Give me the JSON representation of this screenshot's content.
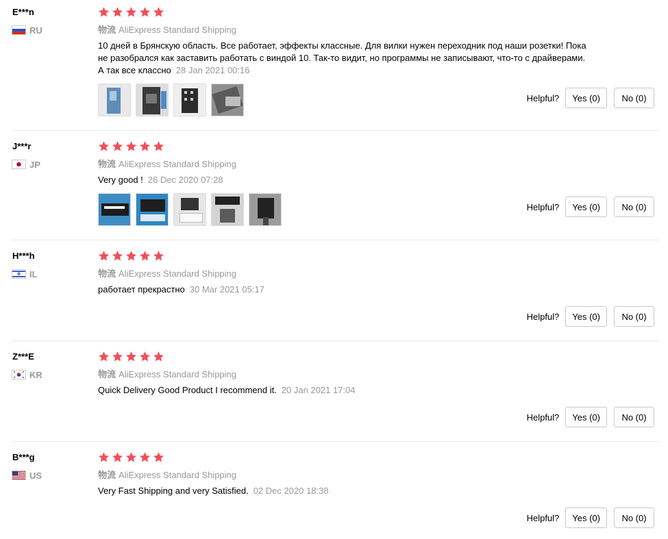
{
  "shipping_label": "物流",
  "helpful_label": "Helpful?",
  "star_color": "#f0505a",
  "reviews": [
    {
      "user": "E***n",
      "country": "RU",
      "flag": "russia-flag-icon",
      "shipping": "AliExpress Standard Shipping",
      "text": "10 дней в Брянскую область. Все работает, эффекты классные. Для вилки нужен переходник под наши розетки! Пока не разобрался как заставить работать с виндой 10. Так-то видит, но программы не записывают, что-то с драйверами. А так все классно",
      "date": "28 Jan 2021 00:16",
      "photo_count": 4,
      "yes": "Yes (0)",
      "no": "No (0)"
    },
    {
      "user": "J***r",
      "country": "JP",
      "flag": "japan-flag-icon",
      "shipping": "AliExpress Standard Shipping",
      "text": "Very good !",
      "date": "26 Dec 2020 07:28",
      "photo_count": 5,
      "yes": "Yes (0)",
      "no": "No (0)"
    },
    {
      "user": "H***h",
      "country": "IL",
      "flag": "israel-flag-icon",
      "shipping": "AliExpress Standard Shipping",
      "text": "работает прекрастно",
      "date": "30 Mar 2021 05:17",
      "photo_count": 0,
      "yes": "Yes (0)",
      "no": "No (0)"
    },
    {
      "user": "Z***E",
      "country": "KR",
      "flag": "south-korea-flag-icon",
      "shipping": "AliExpress Standard Shipping",
      "text": "Quick Delivery Good Product I recommend it.",
      "date": "20 Jan 2021 17:04",
      "photo_count": 0,
      "yes": "Yes (0)",
      "no": "No (0)"
    },
    {
      "user": "B***g",
      "country": "US",
      "flag": "usa-flag-icon",
      "shipping": "AliExpress Standard Shipping",
      "text": "Very Fast Shipping and very Satisfied.",
      "date": "02 Dec 2020 18:38",
      "photo_count": 0,
      "yes": "Yes (0)",
      "no": "No (0)"
    }
  ]
}
